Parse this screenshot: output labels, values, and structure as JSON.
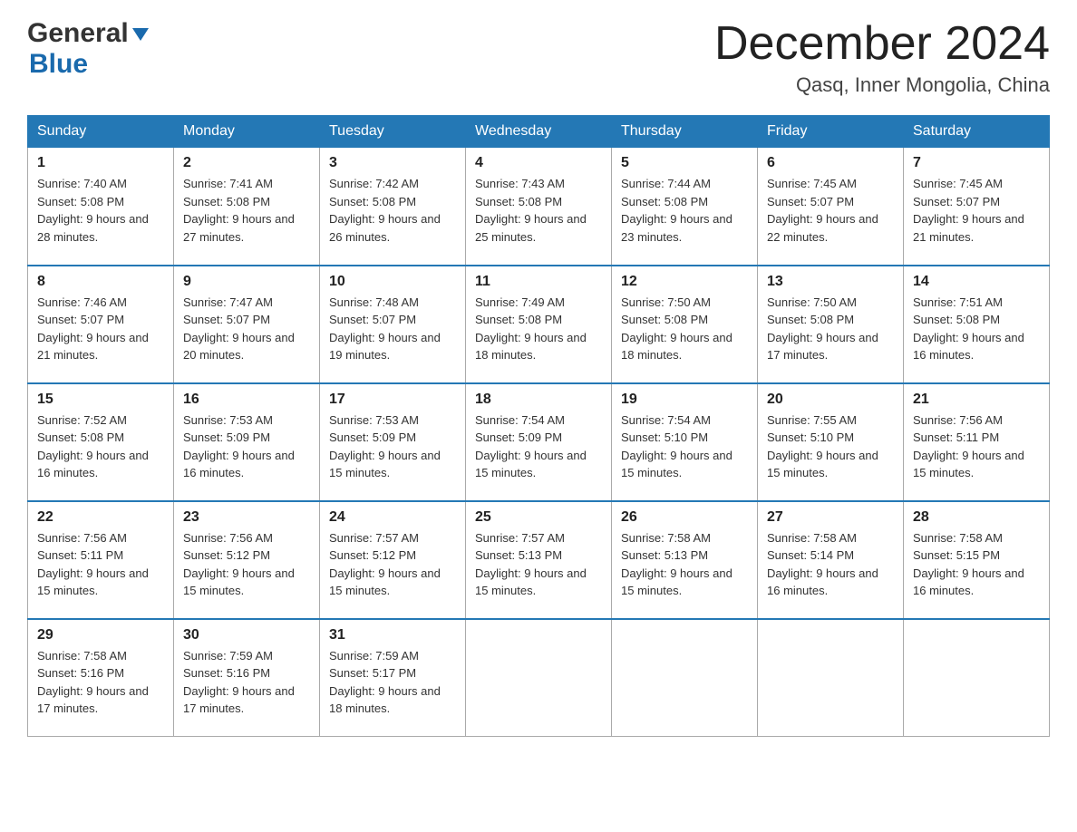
{
  "header": {
    "logo_line1": "General",
    "logo_line2": "Blue",
    "month_title": "December 2024",
    "location": "Qasq, Inner Mongolia, China"
  },
  "days_of_week": [
    "Sunday",
    "Monday",
    "Tuesday",
    "Wednesday",
    "Thursday",
    "Friday",
    "Saturday"
  ],
  "weeks": [
    [
      {
        "day": "1",
        "sunrise": "7:40 AM",
        "sunset": "5:08 PM",
        "daylight": "9 hours and 28 minutes."
      },
      {
        "day": "2",
        "sunrise": "7:41 AM",
        "sunset": "5:08 PM",
        "daylight": "9 hours and 27 minutes."
      },
      {
        "day": "3",
        "sunrise": "7:42 AM",
        "sunset": "5:08 PM",
        "daylight": "9 hours and 26 minutes."
      },
      {
        "day": "4",
        "sunrise": "7:43 AM",
        "sunset": "5:08 PM",
        "daylight": "9 hours and 25 minutes."
      },
      {
        "day": "5",
        "sunrise": "7:44 AM",
        "sunset": "5:08 PM",
        "daylight": "9 hours and 23 minutes."
      },
      {
        "day": "6",
        "sunrise": "7:45 AM",
        "sunset": "5:07 PM",
        "daylight": "9 hours and 22 minutes."
      },
      {
        "day": "7",
        "sunrise": "7:45 AM",
        "sunset": "5:07 PM",
        "daylight": "9 hours and 21 minutes."
      }
    ],
    [
      {
        "day": "8",
        "sunrise": "7:46 AM",
        "sunset": "5:07 PM",
        "daylight": "9 hours and 21 minutes."
      },
      {
        "day": "9",
        "sunrise": "7:47 AM",
        "sunset": "5:07 PM",
        "daylight": "9 hours and 20 minutes."
      },
      {
        "day": "10",
        "sunrise": "7:48 AM",
        "sunset": "5:07 PM",
        "daylight": "9 hours and 19 minutes."
      },
      {
        "day": "11",
        "sunrise": "7:49 AM",
        "sunset": "5:08 PM",
        "daylight": "9 hours and 18 minutes."
      },
      {
        "day": "12",
        "sunrise": "7:50 AM",
        "sunset": "5:08 PM",
        "daylight": "9 hours and 18 minutes."
      },
      {
        "day": "13",
        "sunrise": "7:50 AM",
        "sunset": "5:08 PM",
        "daylight": "9 hours and 17 minutes."
      },
      {
        "day": "14",
        "sunrise": "7:51 AM",
        "sunset": "5:08 PM",
        "daylight": "9 hours and 16 minutes."
      }
    ],
    [
      {
        "day": "15",
        "sunrise": "7:52 AM",
        "sunset": "5:08 PM",
        "daylight": "9 hours and 16 minutes."
      },
      {
        "day": "16",
        "sunrise": "7:53 AM",
        "sunset": "5:09 PM",
        "daylight": "9 hours and 16 minutes."
      },
      {
        "day": "17",
        "sunrise": "7:53 AM",
        "sunset": "5:09 PM",
        "daylight": "9 hours and 15 minutes."
      },
      {
        "day": "18",
        "sunrise": "7:54 AM",
        "sunset": "5:09 PM",
        "daylight": "9 hours and 15 minutes."
      },
      {
        "day": "19",
        "sunrise": "7:54 AM",
        "sunset": "5:10 PM",
        "daylight": "9 hours and 15 minutes."
      },
      {
        "day": "20",
        "sunrise": "7:55 AM",
        "sunset": "5:10 PM",
        "daylight": "9 hours and 15 minutes."
      },
      {
        "day": "21",
        "sunrise": "7:56 AM",
        "sunset": "5:11 PM",
        "daylight": "9 hours and 15 minutes."
      }
    ],
    [
      {
        "day": "22",
        "sunrise": "7:56 AM",
        "sunset": "5:11 PM",
        "daylight": "9 hours and 15 minutes."
      },
      {
        "day": "23",
        "sunrise": "7:56 AM",
        "sunset": "5:12 PM",
        "daylight": "9 hours and 15 minutes."
      },
      {
        "day": "24",
        "sunrise": "7:57 AM",
        "sunset": "5:12 PM",
        "daylight": "9 hours and 15 minutes."
      },
      {
        "day": "25",
        "sunrise": "7:57 AM",
        "sunset": "5:13 PM",
        "daylight": "9 hours and 15 minutes."
      },
      {
        "day": "26",
        "sunrise": "7:58 AM",
        "sunset": "5:13 PM",
        "daylight": "9 hours and 15 minutes."
      },
      {
        "day": "27",
        "sunrise": "7:58 AM",
        "sunset": "5:14 PM",
        "daylight": "9 hours and 16 minutes."
      },
      {
        "day": "28",
        "sunrise": "7:58 AM",
        "sunset": "5:15 PM",
        "daylight": "9 hours and 16 minutes."
      }
    ],
    [
      {
        "day": "29",
        "sunrise": "7:58 AM",
        "sunset": "5:16 PM",
        "daylight": "9 hours and 17 minutes."
      },
      {
        "day": "30",
        "sunrise": "7:59 AM",
        "sunset": "5:16 PM",
        "daylight": "9 hours and 17 minutes."
      },
      {
        "day": "31",
        "sunrise": "7:59 AM",
        "sunset": "5:17 PM",
        "daylight": "9 hours and 18 minutes."
      },
      null,
      null,
      null,
      null
    ]
  ]
}
